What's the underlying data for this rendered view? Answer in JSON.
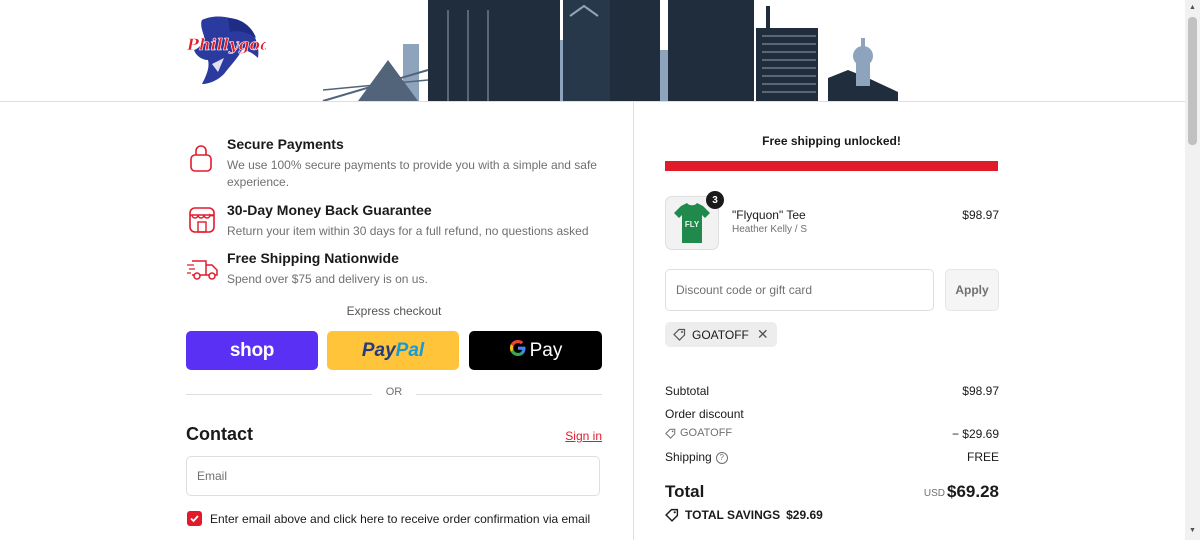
{
  "header": {
    "logo_text": "Phillygoat",
    "logo_icon": "goat-logo-icon"
  },
  "colors": {
    "accent": "#e21b2b",
    "shop_pay": "#5a31f4",
    "paypal": "#ffc439",
    "gpay": "#000000",
    "text_muted": "#707070"
  },
  "trust": [
    {
      "icon": "lock-icon",
      "title": "Secure Payments",
      "desc": "We use 100% secure payments to provide you with a simple and safe experience."
    },
    {
      "icon": "store-icon",
      "title": "30-Day Money Back Guarantee",
      "desc": "Return your item within 30 days for a full refund, no questions asked"
    },
    {
      "icon": "truck-icon",
      "title": "Free Shipping Nationwide",
      "desc": "Spend over $75 and delivery is on us."
    }
  ],
  "express": {
    "label": "Express checkout",
    "shop_label": "shop",
    "paypal_label_1": "Pay",
    "paypal_label_2": "Pal",
    "gpay_g": "G",
    "gpay_label": "Pay",
    "or_label": "OR"
  },
  "contact": {
    "title": "Contact",
    "sign_in": "Sign in",
    "email_placeholder": "Email",
    "checkbox_checked": true,
    "checkbox_label": "Enter email above and click here to receive order confirmation via email"
  },
  "summary": {
    "shipping_message": "Free shipping unlocked!",
    "shipping_progress": 1.0,
    "product": {
      "name": "\"Flyquon\" Tee",
      "variant": "Heather Kelly / S",
      "price": "$98.97",
      "quantity": "3",
      "shirt_text": "FLY"
    },
    "discount_placeholder": "Discount code or gift card",
    "apply_label": "Apply",
    "applied_code": "GOATOFF",
    "subtotal_label": "Subtotal",
    "subtotal_value": "$98.97",
    "order_discount_label": "Order discount",
    "discount_code": "GOATOFF",
    "discount_value": "− $29.69",
    "shipping_label": "Shipping",
    "shipping_value": "FREE",
    "total_label": "Total",
    "total_currency": "USD",
    "total_value": "$69.28",
    "savings_label": "TOTAL SAVINGS",
    "savings_value": "$29.69"
  }
}
